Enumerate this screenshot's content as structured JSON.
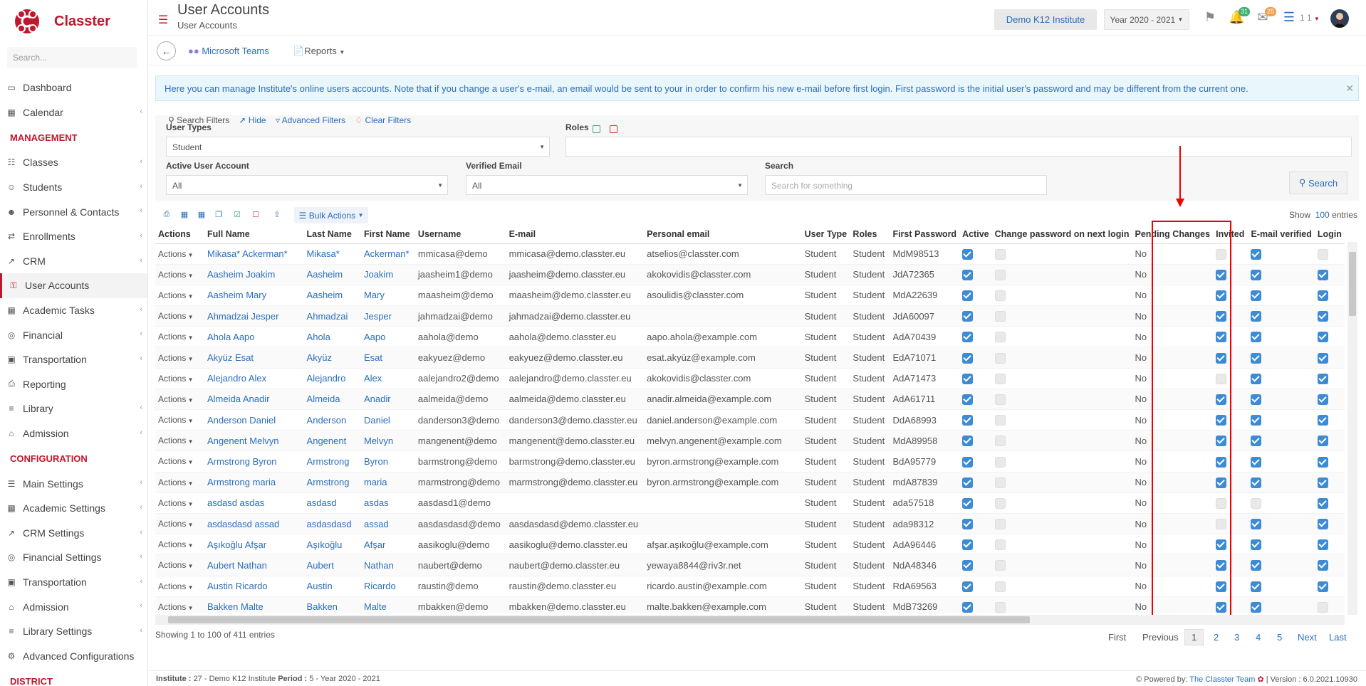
{
  "app": {
    "name": "Classter",
    "brand_color": "#c0172d",
    "link_color": "#2a6ebb"
  },
  "sidebar": {
    "search_placeholder": "Search...",
    "items": [
      {
        "label": "Dashboard",
        "icon": "laptop-icon",
        "chevron": false
      },
      {
        "label": "Calendar",
        "icon": "calendar-icon",
        "chevron": true
      },
      {
        "label": "MANAGEMENT",
        "section": true
      },
      {
        "label": "Classes",
        "icon": "classes-icon",
        "chevron": true
      },
      {
        "label": "Students",
        "icon": "users-icon",
        "chevron": true
      },
      {
        "label": "Personnel & Contacts",
        "icon": "person-icon",
        "chevron": true
      },
      {
        "label": "Enrollments",
        "icon": "exchange-icon",
        "chevron": true
      },
      {
        "label": "CRM",
        "icon": "chart-line-icon",
        "chevron": true
      },
      {
        "label": "User Accounts",
        "icon": "key-icon",
        "chevron": false,
        "active": true
      },
      {
        "label": "Academic Tasks",
        "icon": "grid-icon",
        "chevron": true
      },
      {
        "label": "Financial",
        "icon": "coins-icon",
        "chevron": true
      },
      {
        "label": "Transportation",
        "icon": "bus-icon",
        "chevron": true
      },
      {
        "label": "Reporting",
        "icon": "printer-icon",
        "chevron": false
      },
      {
        "label": "Library",
        "icon": "books-icon",
        "chevron": true
      },
      {
        "label": "Admission",
        "icon": "institution-icon",
        "chevron": true
      },
      {
        "label": "CONFIGURATION",
        "section": true
      },
      {
        "label": "Main Settings",
        "icon": "settings-list-icon",
        "chevron": true
      },
      {
        "label": "Academic Settings",
        "icon": "grid-icon",
        "chevron": true
      },
      {
        "label": "CRM Settings",
        "icon": "chart-line-icon",
        "chevron": true
      },
      {
        "label": "Financial Settings",
        "icon": "coins-icon",
        "chevron": true
      },
      {
        "label": "Transportation",
        "icon": "bus-icon",
        "chevron": true
      },
      {
        "label": "Admission",
        "icon": "institution-icon",
        "chevron": true
      },
      {
        "label": "Library Settings",
        "icon": "books-icon",
        "chevron": true
      },
      {
        "label": "Advanced Configurations",
        "icon": "gears-icon",
        "chevron": false
      },
      {
        "label": "DISTRICT",
        "section": true
      }
    ]
  },
  "header": {
    "title": "User Accounts",
    "subtitle": "User Accounts",
    "institute": "Demo K12 Institute",
    "year": "Year 2020 - 2021",
    "notif_count": "31",
    "mail_count": "25",
    "user": "1 1"
  },
  "toolbar": {
    "teams": "Microsoft Teams",
    "reports": "Reports"
  },
  "info": "Here you can manage Institute's online users accounts. Note that if you change a user's e-mail, an email would be sent to your in order to confirm his new e-mail before first login. First password is the initial user's password and may be different from the current one.",
  "filters": {
    "search_filters": "Search Filters",
    "hide": "Hide",
    "advanced": "Advanced Filters",
    "clear": "Clear Filters",
    "user_types_label": "User Types",
    "user_types_value": "Student",
    "roles_label": "Roles",
    "active_label": "Active User Account",
    "active_value": "All",
    "verified_label": "Verified Email",
    "verified_value": "All",
    "search_label": "Search",
    "search_placeholder": "Search for something",
    "search_button": "Search"
  },
  "table": {
    "bulk_actions": "Bulk Actions",
    "show_label": "Show",
    "show_count": "100",
    "entries_label": "entries",
    "columns": [
      "Actions",
      "Full Name",
      "Last Name",
      "First Name",
      "Username",
      "E-mail",
      "Personal email",
      "User Type",
      "Roles",
      "First Password",
      "Active",
      "Change password on next login",
      "Pending Changes",
      "Invited",
      "E-mail verified",
      "Login"
    ],
    "rows": [
      {
        "full": "Mikasa* Ackerman*",
        "last": "Mikasa*",
        "first": "Ackerman*",
        "user": "mmicasa@demo",
        "email": "mmicasa@demo.classter.eu",
        "personal": "atselios@classter.com",
        "type": "Student",
        "role": "Student",
        "pw": "MdM98513",
        "active": true,
        "change": false,
        "pending": "No",
        "invited": false,
        "verified": true,
        "login": false
      },
      {
        "full": "Aasheim Joakim",
        "last": "Aasheim",
        "first": "Joakim",
        "user": "jaasheim1@demo",
        "email": "jaasheim@demo.classter.eu",
        "personal": "akokovidis@classter.com",
        "type": "Student",
        "role": "Student",
        "pw": "JdA72365",
        "active": true,
        "change": false,
        "pending": "No",
        "invited": true,
        "verified": true,
        "login": true
      },
      {
        "full": "Aasheim Mary",
        "last": "Aasheim",
        "first": "Mary",
        "user": "maasheim@demo",
        "email": "maasheim@demo.classter.eu",
        "personal": "asoulidis@classter.com",
        "type": "Student",
        "role": "Student",
        "pw": "MdA22639",
        "active": true,
        "change": false,
        "pending": "No",
        "invited": true,
        "verified": true,
        "login": true
      },
      {
        "full": "Ahmadzai Jesper",
        "last": "Ahmadzai",
        "first": "Jesper",
        "user": "jahmadzai@demo",
        "email": "jahmadzai@demo.classter.eu",
        "personal": "",
        "type": "Student",
        "role": "Student",
        "pw": "JdA60097",
        "active": true,
        "change": false,
        "pending": "No",
        "invited": true,
        "verified": true,
        "login": true
      },
      {
        "full": "Ahola Aapo",
        "last": "Ahola",
        "first": "Aapo",
        "user": "aahola@demo",
        "email": "aahola@demo.classter.eu",
        "personal": "aapo.ahola@example.com",
        "type": "Student",
        "role": "Student",
        "pw": "AdA70439",
        "active": true,
        "change": false,
        "pending": "No",
        "invited": true,
        "verified": true,
        "login": true
      },
      {
        "full": "Akyüz Esat",
        "last": "Akyüz",
        "first": "Esat",
        "user": "eakyuez@demo",
        "email": "eakyuez@demo.classter.eu",
        "personal": "esat.akyüz@example.com",
        "type": "Student",
        "role": "Student",
        "pw": "EdA71071",
        "active": true,
        "change": false,
        "pending": "No",
        "invited": true,
        "verified": true,
        "login": true
      },
      {
        "full": "Alejandro Alex",
        "last": "Alejandro",
        "first": "Alex",
        "user": "aalejandro2@demo",
        "email": "aalejandro@demo.classter.eu",
        "personal": "akokovidis@classter.com",
        "type": "Student",
        "role": "Student",
        "pw": "AdA71473",
        "active": true,
        "change": false,
        "pending": "No",
        "invited": false,
        "verified": true,
        "login": true
      },
      {
        "full": "Almeida Anadir",
        "last": "Almeida",
        "first": "Anadir",
        "user": "aalmeida@demo",
        "email": "aalmeida@demo.classter.eu",
        "personal": "anadir.almeida@example.com",
        "type": "Student",
        "role": "Student",
        "pw": "AdA61711",
        "active": true,
        "change": false,
        "pending": "No",
        "invited": true,
        "verified": true,
        "login": true
      },
      {
        "full": "Anderson Daniel",
        "last": "Anderson",
        "first": "Daniel",
        "user": "danderson3@demo",
        "email": "danderson3@demo.classter.eu",
        "personal": "daniel.anderson@example.com",
        "type": "Student",
        "role": "Student",
        "pw": "DdA68993",
        "active": true,
        "change": false,
        "pending": "No",
        "invited": true,
        "verified": true,
        "login": true
      },
      {
        "full": "Angenent Melvyn",
        "last": "Angenent",
        "first": "Melvyn",
        "user": "mangenent@demo",
        "email": "mangenent@demo.classter.eu",
        "personal": "melvyn.angenent@example.com",
        "type": "Student",
        "role": "Student",
        "pw": "MdA89958",
        "active": true,
        "change": false,
        "pending": "No",
        "invited": true,
        "verified": true,
        "login": true
      },
      {
        "full": "Armstrong Byron",
        "last": "Armstrong",
        "first": "Byron",
        "user": "barmstrong@demo",
        "email": "barmstrong@demo.classter.eu",
        "personal": "byron.armstrong@example.com",
        "type": "Student",
        "role": "Student",
        "pw": "BdA95779",
        "active": true,
        "change": false,
        "pending": "No",
        "invited": true,
        "verified": true,
        "login": true
      },
      {
        "full": "Armstrong maria",
        "last": "Armstrong",
        "first": "maria",
        "user": "marmstrong@demo",
        "email": "marmstrong@demo.classter.eu",
        "personal": "byron.armstrong@example.com",
        "type": "Student",
        "role": "Student",
        "pw": "mdA87839",
        "active": true,
        "change": false,
        "pending": "No",
        "invited": true,
        "verified": true,
        "login": true
      },
      {
        "full": "asdasd asdas",
        "last": "asdasd",
        "first": "asdas",
        "user": "aasdasd1@demo",
        "email": "",
        "personal": "",
        "type": "Student",
        "role": "Student",
        "pw": "ada57518",
        "active": true,
        "change": false,
        "pending": "No",
        "invited": false,
        "verified": false,
        "login": true
      },
      {
        "full": "asdasdasd assad",
        "last": "asdasdasd",
        "first": "assad",
        "user": "aasdasdasd@demo",
        "email": "aasdasdasd@demo.classter.eu",
        "personal": "",
        "type": "Student",
        "role": "Student",
        "pw": "ada98312",
        "active": true,
        "change": false,
        "pending": "No",
        "invited": false,
        "verified": true,
        "login": true
      },
      {
        "full": "Aşıkoğlu Afşar",
        "last": "Aşıkoğlu",
        "first": "Afşar",
        "user": "aasikoglu@demo",
        "email": "aasikoglu@demo.classter.eu",
        "personal": "afşar.aşıkoğlu@example.com",
        "type": "Student",
        "role": "Student",
        "pw": "AdA96446",
        "active": true,
        "change": false,
        "pending": "No",
        "invited": true,
        "verified": true,
        "login": true
      },
      {
        "full": "Aubert Nathan",
        "last": "Aubert",
        "first": "Nathan",
        "user": "naubert@demo",
        "email": "naubert@demo.classter.eu",
        "personal": "yewaya8844@riv3r.net",
        "type": "Student",
        "role": "Student",
        "pw": "NdA48346",
        "active": true,
        "change": false,
        "pending": "No",
        "invited": true,
        "verified": true,
        "login": true
      },
      {
        "full": "Austin Ricardo",
        "last": "Austin",
        "first": "Ricardo",
        "user": "raustin@demo",
        "email": "raustin@demo.classter.eu",
        "personal": "ricardo.austin@example.com",
        "type": "Student",
        "role": "Student",
        "pw": "RdA69563",
        "active": true,
        "change": false,
        "pending": "No",
        "invited": true,
        "verified": true,
        "login": true
      },
      {
        "full": "Bakken Malte",
        "last": "Bakken",
        "first": "Malte",
        "user": "mbakken@demo",
        "email": "mbakken@demo.classter.eu",
        "personal": "malte.bakken@example.com",
        "type": "Student",
        "role": "Student",
        "pw": "MdB73269",
        "active": true,
        "change": false,
        "pending": "No",
        "invited": true,
        "verified": true,
        "login": false
      }
    ],
    "actions_label": "Actions"
  },
  "pager": {
    "showing": "Showing 1 to 100 of 411 entries",
    "first": "First",
    "previous": "Previous",
    "pages": [
      "1",
      "2",
      "3",
      "4",
      "5"
    ],
    "next": "Next",
    "last": "Last"
  },
  "footer": {
    "institute_label": "Institute :",
    "institute_value": "27 - Demo K12 Institute",
    "period_label": "Period :",
    "period_value": "5 - Year 2020 - 2021",
    "powered": "Powered by:",
    "team": "The Classter Team",
    "version": "| Version : 6.0.2021.10930"
  }
}
